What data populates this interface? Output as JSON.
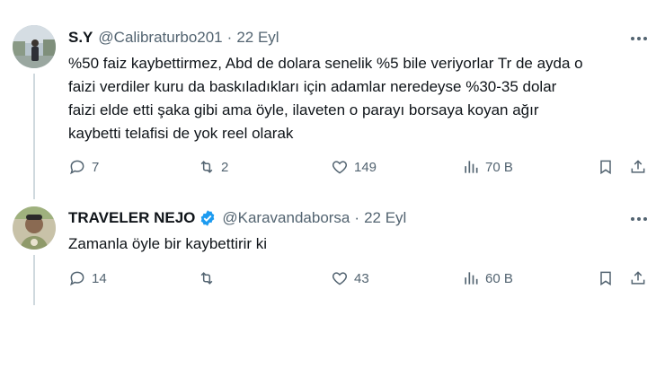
{
  "tweets": [
    {
      "name": "S.Y",
      "handle": "@Calibraturbo201",
      "dot": "·",
      "date": "22 Eyl",
      "text": "%50 faiz kaybettirmez, Abd de dolara senelik %5 bile veriyorlar Tr de ayda o\nfaizi verdiler kuru da baskıladıkları için adamlar neredeyse %30-35 dolar\nfaizi elde etti şaka gibi ama öyle, ilaveten o parayı borsaya koyan ağır\nkaybetti telafisi de yok reel olarak",
      "replies": "7",
      "retweets": "2",
      "likes": "149",
      "views": "70 B",
      "verified": false
    },
    {
      "name": "TRAVELER NEJO",
      "handle": "@Karavandaborsa",
      "dot": "·",
      "date": "22 Eyl",
      "text": "Zamanla öyle bir kaybettirir ki",
      "replies": "14",
      "retweets": "",
      "likes": "43",
      "views": "60 B",
      "verified": true
    }
  ],
  "icons": {
    "reply": "speech-bubble-icon",
    "retweet": "retweet-arrows-icon",
    "like": "heart-icon",
    "views": "bar-chart-icon",
    "bookmark": "bookmark-icon",
    "share": "share-upload-icon",
    "more": "more-dots-icon",
    "verified": "verified-badge-icon"
  },
  "colors": {
    "text": "#0f1419",
    "secondary": "#536471",
    "verified": "#1d9bf0",
    "thread_line": "#cfd9de"
  }
}
